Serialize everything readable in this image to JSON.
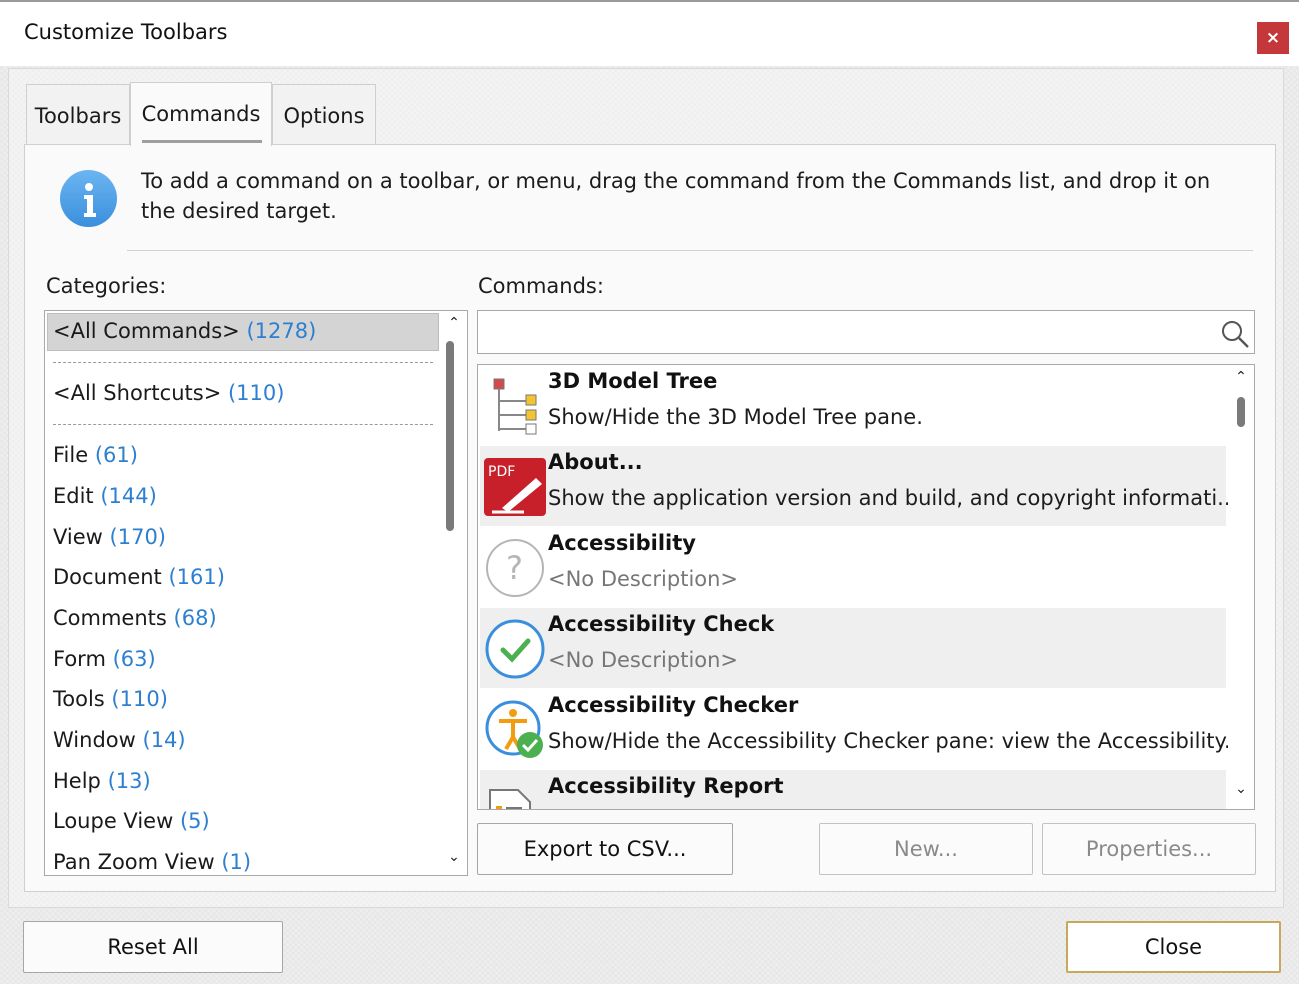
{
  "window": {
    "title": "Customize Toolbars",
    "close_glyph": "×"
  },
  "tabs": [
    {
      "label": "Toolbars"
    },
    {
      "label": "Commands"
    },
    {
      "label": "Options"
    }
  ],
  "info": {
    "text": "To add a command on a toolbar, or menu, drag the command from the Commands list, and drop it on the desired target."
  },
  "categories": {
    "label": "Categories:",
    "items": [
      {
        "name": "<All Commands>",
        "count": "(1278)"
      },
      {
        "name": "<All Shortcuts>",
        "count": "(110)"
      },
      {
        "name": "File",
        "count": "(61)"
      },
      {
        "name": "Edit",
        "count": "(144)"
      },
      {
        "name": "View",
        "count": "(170)"
      },
      {
        "name": "Document",
        "count": "(161)"
      },
      {
        "name": "Comments",
        "count": "(68)"
      },
      {
        "name": "Form",
        "count": "(63)"
      },
      {
        "name": "Tools",
        "count": "(110)"
      },
      {
        "name": "Window",
        "count": "(14)"
      },
      {
        "name": "Help",
        "count": "(13)"
      },
      {
        "name": "Loupe View",
        "count": "(5)"
      },
      {
        "name": "Pan Zoom View",
        "count": "(1)"
      }
    ]
  },
  "commands": {
    "label": "Commands:",
    "search_value": "",
    "items": [
      {
        "name": "3D Model Tree",
        "desc": "Show/Hide the 3D Model Tree pane.",
        "icon": "3d-model-tree-icon"
      },
      {
        "name": "About...",
        "desc": "Show the application version and build, and copyright informati...",
        "icon": "pdf-about-icon"
      },
      {
        "name": "Accessibility",
        "desc": "<No Description>",
        "icon": "question-icon"
      },
      {
        "name": "Accessibility Check",
        "desc": "<No Description>",
        "icon": "check-circle-icon"
      },
      {
        "name": "Accessibility Checker",
        "desc": "Show/Hide the Accessibility Checker pane: view the Accessibility...",
        "icon": "accessibility-checker-icon"
      },
      {
        "name": "Accessibility Report",
        "desc": "",
        "icon": "report-icon"
      }
    ]
  },
  "buttons": {
    "export": "Export to CSV...",
    "new": "New...",
    "properties": "Properties...",
    "reset_all": "Reset All",
    "close": "Close"
  },
  "colors": {
    "accent": "#2d7fd0",
    "close_red": "#c4373a",
    "pdf_red": "#c8202a"
  }
}
